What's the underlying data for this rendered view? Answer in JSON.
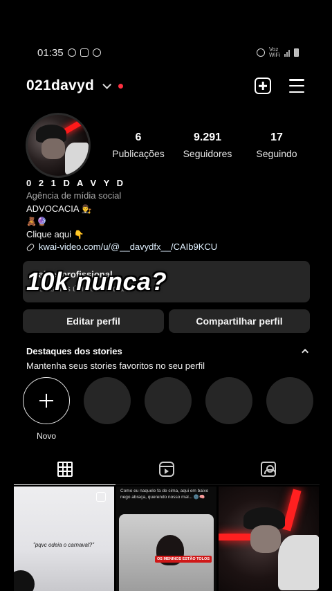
{
  "status_bar": {
    "time": "01:35",
    "network_label": "Voz",
    "network_sublabel": "WiFi"
  },
  "header": {
    "username": "021davyd",
    "icons": [
      "chevron-down-icon",
      "notification-dot",
      "create-post-icon",
      "menu-icon"
    ]
  },
  "stats": {
    "posts": {
      "value": "6",
      "label": "Publicações"
    },
    "followers": {
      "value": "9.291",
      "label": "Seguidores"
    },
    "following": {
      "value": "17",
      "label": "Seguindo"
    }
  },
  "bio": {
    "name": "0 2 1 D A V Y D",
    "category": "Agência de mídia social",
    "line1": "ADVOCACIA",
    "line1_emoji": "👨‍⚖️",
    "line2_emoji": "🧸🔮",
    "line3": "Clique aqui",
    "line3_emoji": "👇",
    "link": "kwai-video.com/u/@__davydfx__/CAIb9KCU"
  },
  "professional_panel": {
    "title": "Painel profissional",
    "subtitle": "...stas nos últimos 30 dias."
  },
  "overlay_text": "10k nunca?",
  "buttons": {
    "edit": "Editar perfil",
    "share": "Compartilhar perfil"
  },
  "highlights": {
    "title": "Destaques dos stories",
    "subtitle": "Mantenha seus stories favoritos no seu perfil",
    "new_label": "Novo"
  },
  "tabs": [
    "grid-icon",
    "reels-icon",
    "tagged-icon"
  ],
  "posts": {
    "post1_caption": "\"pqvc odeia o carnaval?\"",
    "post2_text": "Como eu naquele fa de cima, aqui em baixo nego abraça, querendo nosso mal... 🌚🧠",
    "post2_sticker": "OS MENINOS ESTÃO TOLOS"
  },
  "colors": {
    "background": "#000000",
    "panel": "#262626",
    "accent_red": "#ff3040",
    "secondary_text": "#a8a8a8"
  }
}
